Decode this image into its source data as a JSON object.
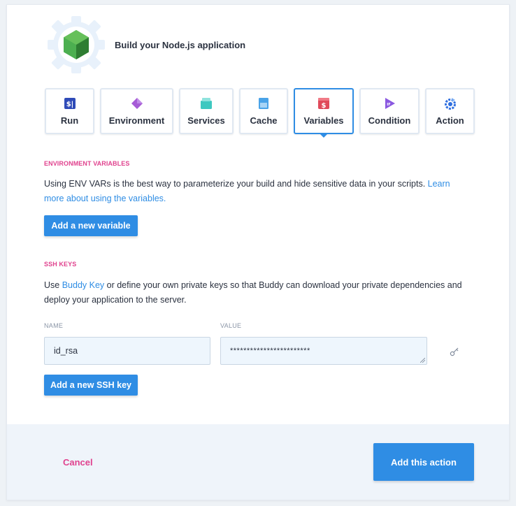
{
  "header": {
    "app_title": "Build your Node.js application",
    "logo_icon": "nodejs-hexagon-icon"
  },
  "tabs": [
    {
      "label": "Run",
      "icon": "run-terminal-icon",
      "color": "#2f4bb8"
    },
    {
      "label": "Environment",
      "icon": "diamond-icon",
      "color": "#a65bd6"
    },
    {
      "label": "Services",
      "icon": "services-box-icon",
      "color": "#3ec8c0"
    },
    {
      "label": "Cache",
      "icon": "cache-folder-icon",
      "color": "#4aa3e8"
    },
    {
      "label": "Variables",
      "icon": "dollar-icon",
      "color": "#e04a5a",
      "active": true
    },
    {
      "label": "Condition",
      "icon": "condition-play-icon",
      "color": "#8a58e0"
    },
    {
      "label": "Action",
      "icon": "action-gear-icon",
      "color": "#2f6fe0"
    }
  ],
  "env": {
    "section_label": "ENVIRONMENT VARIABLES",
    "text": "Using ENV VARs is the best way to parameterize your build and hide sensitive data in your scripts. ",
    "link_text": "Learn more about using the variables.",
    "button_label": "Add a new variable"
  },
  "ssh": {
    "section_label": "SSH KEYS",
    "text_prefix": "Use ",
    "link_text": "Buddy Key",
    "text_suffix": " or define your own private keys so that Buddy can download your private dependencies and deploy your application to the server.",
    "name_label": "NAME",
    "value_label": "VALUE",
    "name_value": "id_rsa",
    "value_value": "************************",
    "key_icon": "key-icon",
    "button_label": "Add a new SSH key"
  },
  "footer": {
    "cancel_label": "Cancel",
    "submit_label": "Add this action"
  },
  "colors": {
    "accent": "#2f8de4",
    "pink": "#e0428e"
  }
}
